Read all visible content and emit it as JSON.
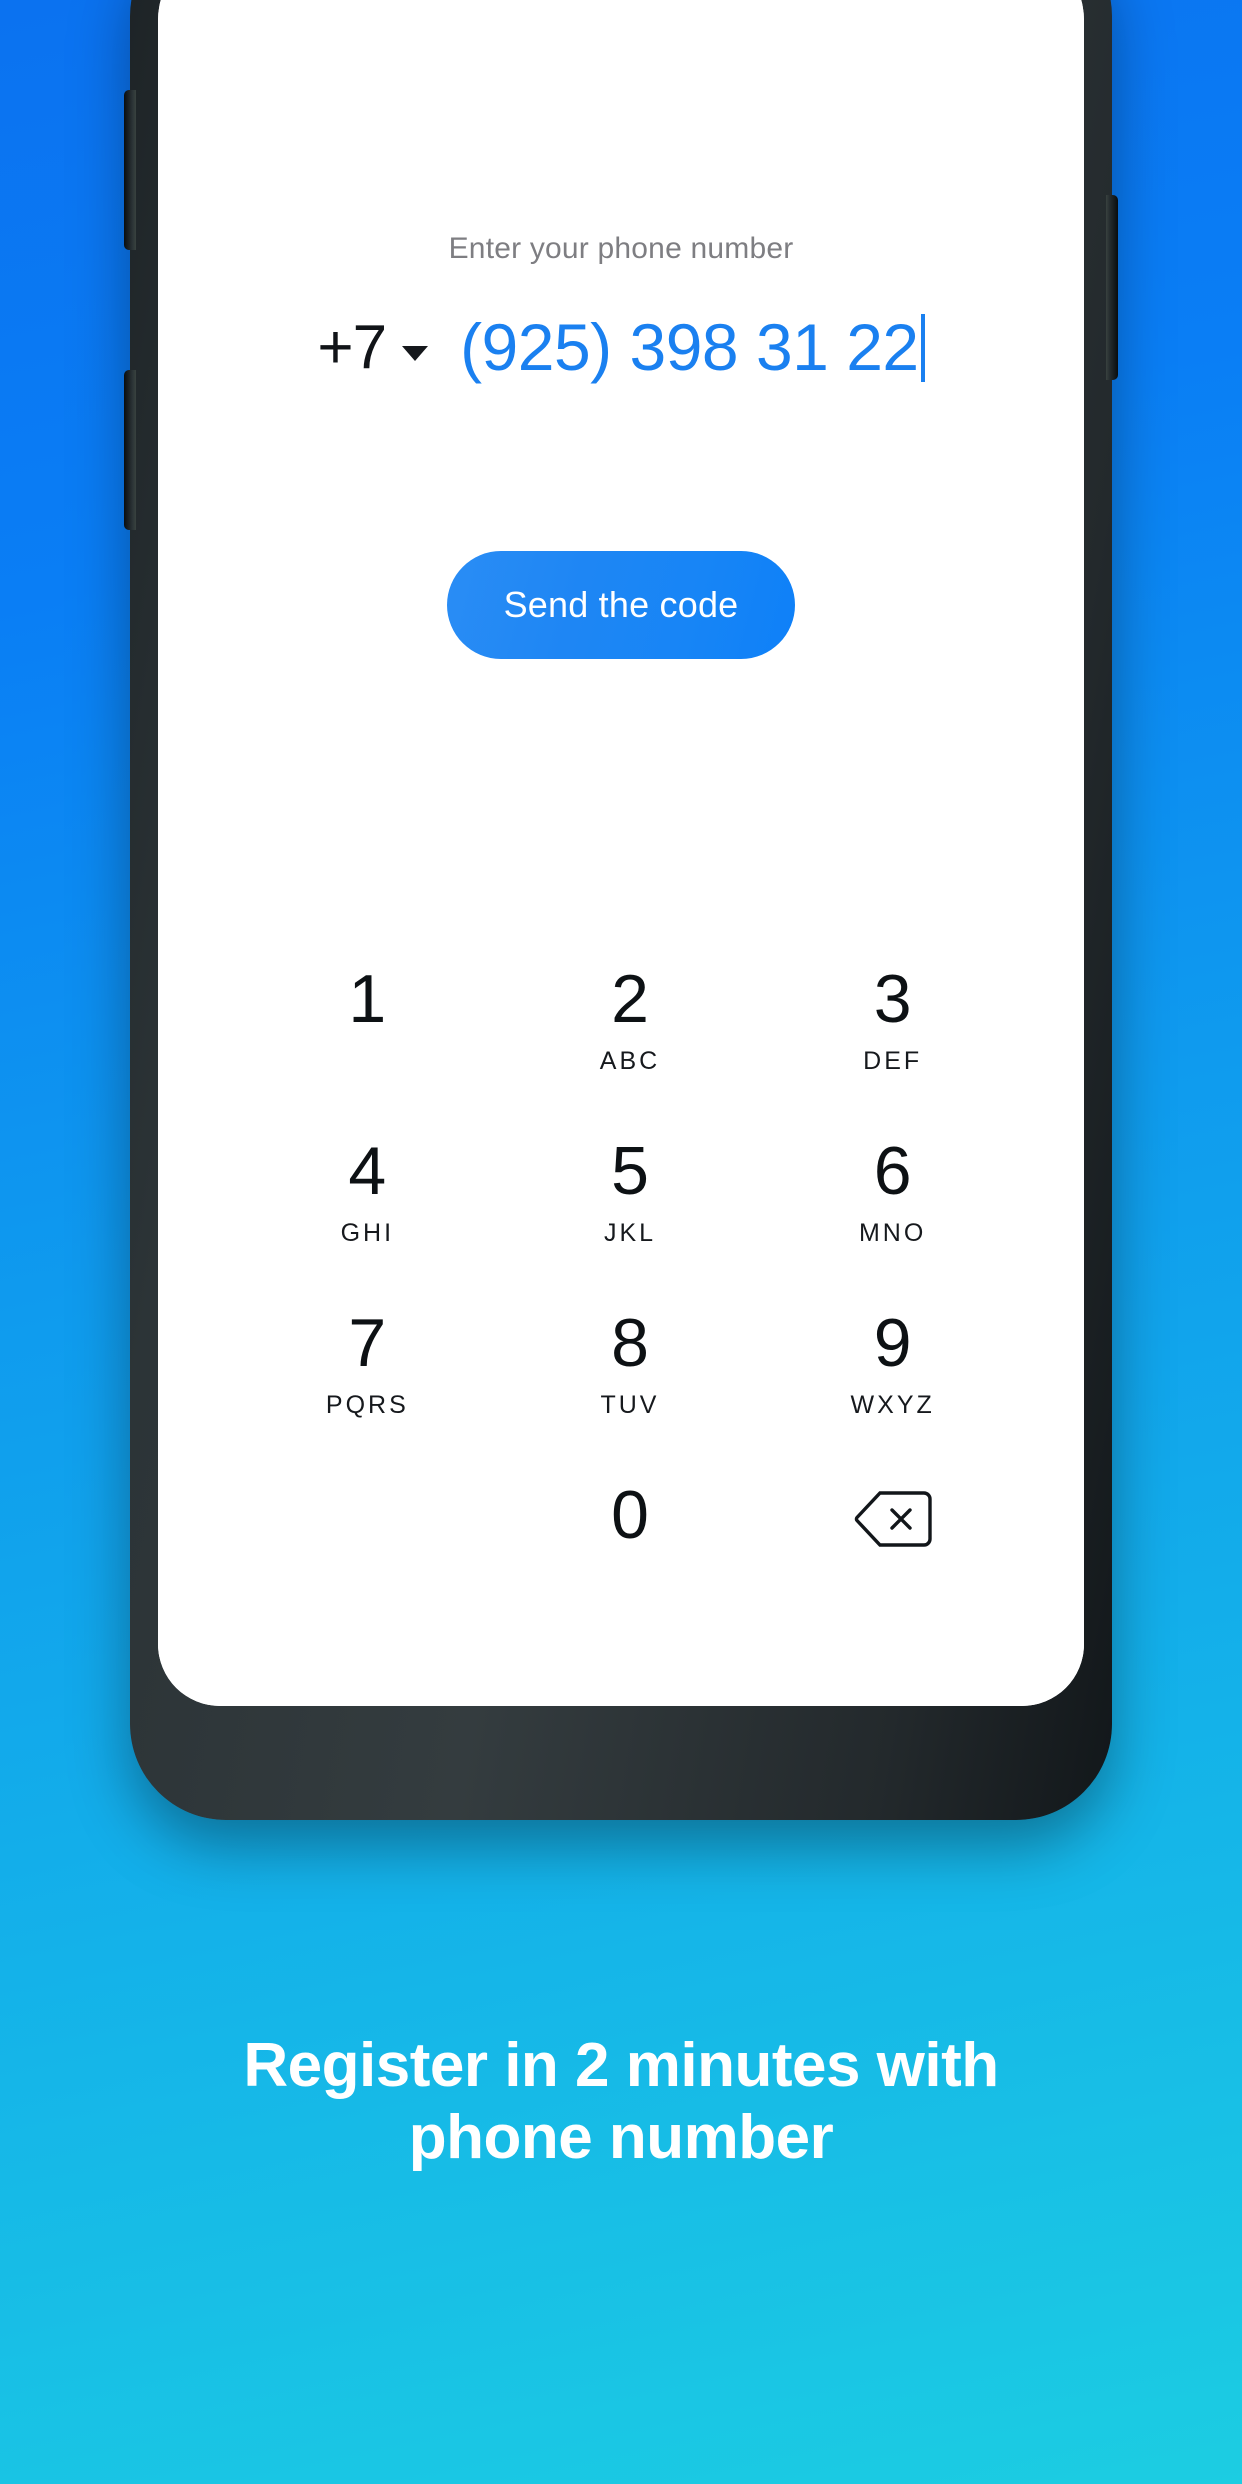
{
  "background": {
    "gradient_from": "#0b72f0",
    "gradient_to": "#1ccde2"
  },
  "device": {
    "frame_color": "#2c3437",
    "buttons": {
      "volume_up": "volume-up-button",
      "volume_down": "volume-down-button",
      "power": "power-button"
    }
  },
  "app": {
    "prompt": "Enter your phone number",
    "country_code": "+7",
    "phone_number": "(925) 398 31 22",
    "send_button": "Send the code",
    "accent_color": "#1a80f0",
    "keypad": [
      {
        "digit": "1",
        "letters": ""
      },
      {
        "digit": "2",
        "letters": "ABC"
      },
      {
        "digit": "3",
        "letters": "DEF"
      },
      {
        "digit": "4",
        "letters": "GHI"
      },
      {
        "digit": "5",
        "letters": "JKL"
      },
      {
        "digit": "6",
        "letters": "MNO"
      },
      {
        "digit": "7",
        "letters": "PQRS"
      },
      {
        "digit": "8",
        "letters": "TUV"
      },
      {
        "digit": "9",
        "letters": "WXYZ"
      },
      {
        "digit": "",
        "letters": ""
      },
      {
        "digit": "0",
        "letters": ""
      }
    ],
    "backspace_icon": "backspace-icon"
  },
  "caption": {
    "line1": "Register in 2 minutes with",
    "line2": "phone number",
    "color": "#ffffff"
  }
}
